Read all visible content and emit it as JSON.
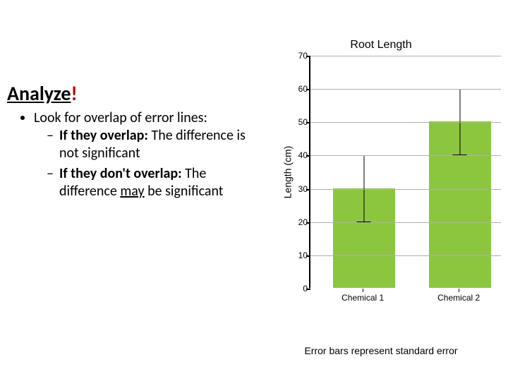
{
  "heading": {
    "text": "Analyze",
    "bang": "!"
  },
  "bullets": {
    "main": "Look for overlap of error lines:",
    "sub1_lead": "If they overlap:",
    "sub1_rest": "  The difference is not significant",
    "sub2_lead": "If they don't overlap:",
    "sub2_rest_a": " The difference ",
    "sub2_rest_may": "may",
    "sub2_rest_b": " be significant"
  },
  "chart_data": {
    "type": "bar",
    "title": "Root Length",
    "ylabel": "Length (cm)",
    "xlabel": "",
    "ylim": [
      0,
      70
    ],
    "yticks": [
      0,
      10,
      20,
      30,
      40,
      50,
      60,
      70
    ],
    "categories": [
      "Chemical 1",
      "Chemical 2"
    ],
    "values": [
      30,
      50
    ],
    "error": [
      10,
      10
    ],
    "caption": "Error bars represent standard error",
    "bar_color": "#8cc63f"
  }
}
